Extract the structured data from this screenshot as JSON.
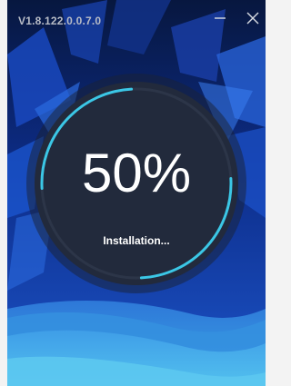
{
  "window": {
    "version": "V1.8.122.0.0.7.0"
  },
  "titlebar": {
    "minimize_icon": "minimize-icon",
    "close_icon": "close-icon"
  },
  "progress": {
    "percent_label": "50%",
    "value": 0.5,
    "status": "Installation..."
  },
  "colors": {
    "accent": "#3bc7e6",
    "dial": "#222a3c",
    "background_top": "#0b1f55",
    "wave_light": "#4aaee9"
  }
}
